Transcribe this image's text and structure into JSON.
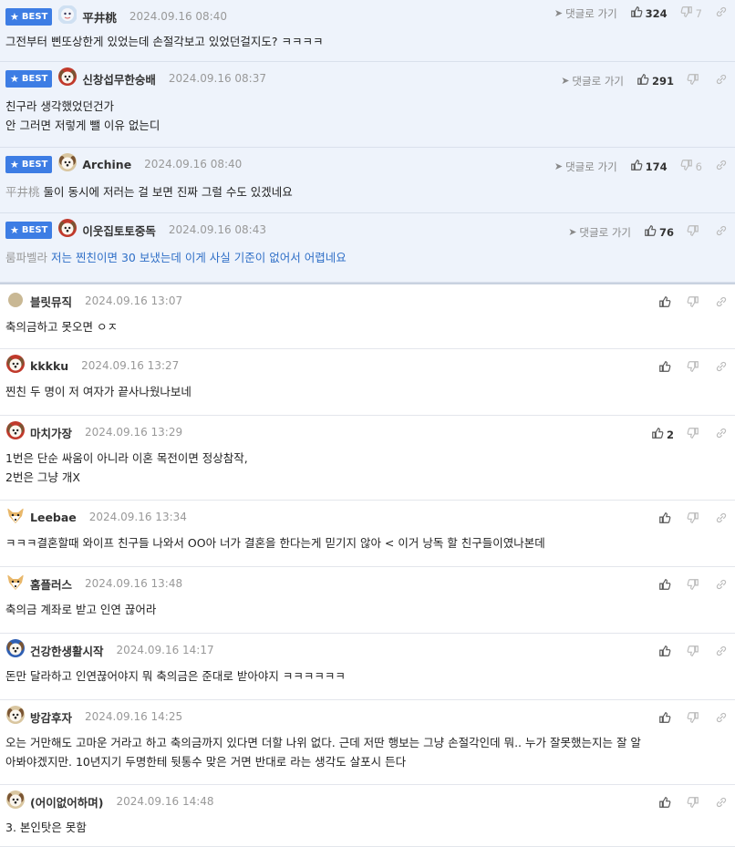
{
  "labels": {
    "best": "BEST",
    "goto": "댓글로 가기"
  },
  "comments": [
    {
      "nick": "平井桃",
      "time": "2024.09.16 08:40",
      "best": true,
      "up": "324",
      "down": "7",
      "mention": "",
      "lines": [
        "그전부터 삔또상한게 있었는데 손절각보고 있었던걸지도? ㅋㅋㅋㅋ"
      ],
      "avatar": "blue-face"
    },
    {
      "nick": "신창섭무한숭배",
      "time": "2024.09.16 08:37",
      "best": true,
      "up": "291",
      "down": "",
      "mention": "",
      "lines": [
        "친구라 생각했었던건가",
        "안 그러면 저렇게 뺄 이유 없는디"
      ],
      "avatar": "dog-red"
    },
    {
      "nick": "Archine",
      "time": "2024.09.16 08:40",
      "best": true,
      "up": "174",
      "down": "6",
      "mention": "平井桃",
      "lines": [
        "둘이 동시에 저러는 걸 보면 진짜 그럴 수도 있겠네요"
      ],
      "avatar": "dog-tan"
    },
    {
      "nick": "이웃집토토중독",
      "time": "2024.09.16 08:43",
      "best": true,
      "up": "76",
      "down": "",
      "mention": "룸파벨라",
      "lines": [
        "저는 찐친이면 30 보냈는데 이게 사실 기준이 없어서 어렵네요"
      ],
      "avatar": "dog-red",
      "blue": true
    },
    {
      "nick": "블릿뮤직",
      "time": "2024.09.16 13:07",
      "best": false,
      "up": "",
      "down": "",
      "mention": "",
      "lines": [
        "축의금하고 못오면 ㅇㅈ"
      ],
      "avatar": "dot"
    },
    {
      "nick": "kkkku",
      "time": "2024.09.16 13:27",
      "best": false,
      "up": "",
      "down": "",
      "mention": "",
      "lines": [
        "찐친 두 명이 저 여자가 끝사나웠나보네"
      ],
      "avatar": "dog-red"
    },
    {
      "nick": "마치가장",
      "time": "2024.09.16 13:29",
      "best": false,
      "up": "2",
      "down": "",
      "mention": "",
      "lines": [
        "1번은 단순 싸움이 아니라 이혼 목전이면 정상참작,",
        "2번은 그냥 개X"
      ],
      "avatar": "dog-red"
    },
    {
      "nick": "Leebae",
      "time": "2024.09.16 13:34",
      "best": false,
      "up": "",
      "down": "",
      "mention": "",
      "lines": [
        "ㅋㅋㅋ결혼할때 와이프 친구들 나와서 OO아 너가 결혼을 한다는게 믿기지 않아 < 이거 낭독 할 친구들이였나본데"
      ],
      "avatar": "fox"
    },
    {
      "nick": "홈플러스",
      "time": "2024.09.16 13:48",
      "best": false,
      "up": "",
      "down": "",
      "mention": "",
      "lines": [
        "축의금 계좌로 받고 인연 끊어라"
      ],
      "avatar": "fox"
    },
    {
      "nick": "건강한생활시작",
      "time": "2024.09.16 14:17",
      "best": false,
      "up": "",
      "down": "",
      "mention": "",
      "lines": [
        "돈만 달라하고 인연끊어야지 뭐 축의금은 준대로 받아야지 ㅋㅋㅋㅋㅋㅋ"
      ],
      "avatar": "dog-blue"
    },
    {
      "nick": "방감후자",
      "time": "2024.09.16 14:25",
      "best": false,
      "up": "",
      "down": "",
      "mention": "",
      "lines": [
        "오는 거만해도 고마운 거라고 하고 축의금까지 있다면 더할 나위 없다. 근데 저딴 행보는 그냥 손절각인데 뭐.. 누가 잘못했는지는 잘 알",
        "아봐야겠지만. 10년지기 두명한테 뒷통수 맞은 거면 반대로 라는 생각도 살포시 든다"
      ],
      "avatar": "dog-tan"
    },
    {
      "nick": "(어이없어하며)",
      "time": "2024.09.16 14:48",
      "best": false,
      "up": "",
      "down": "",
      "mention": "",
      "lines": [
        "3. 본인탓은 못함"
      ],
      "avatar": "dog-tan"
    }
  ],
  "colors": {
    "accent": "#3d7de4",
    "best_bg": "#eef3fb"
  },
  "icons": {
    "up": "thumbs-up-icon",
    "down": "thumbs-down-icon",
    "link": "link-icon",
    "goto": "arrow-icon",
    "star": "star-icon"
  }
}
